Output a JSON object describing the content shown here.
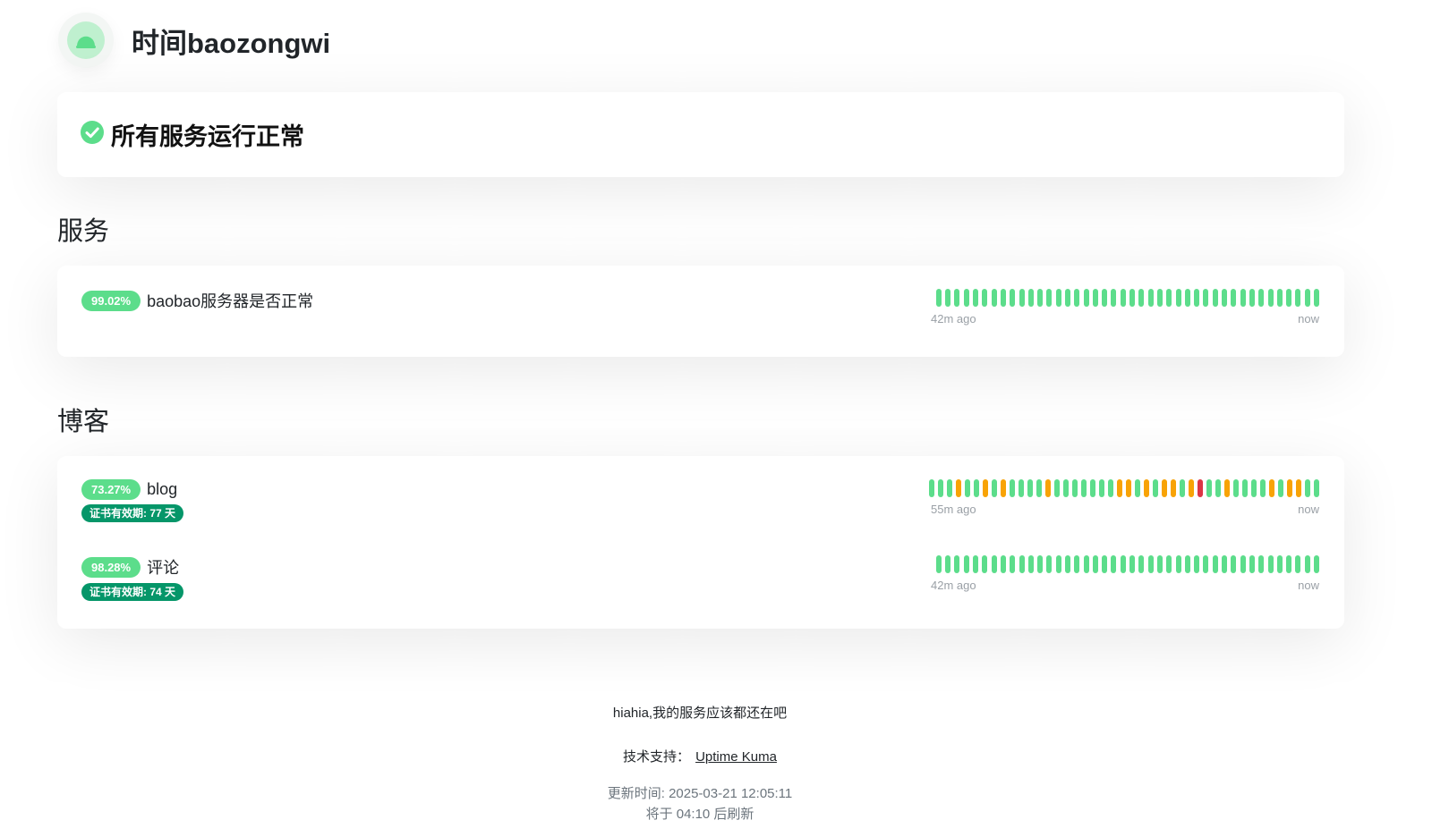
{
  "header": {
    "title": "时间baozongwi",
    "logo_icon": "kuma-logo-icon"
  },
  "overall_status": {
    "text": "所有服务运行正常",
    "icon": "check-circle-icon",
    "color": "#5cdd8b"
  },
  "colors": {
    "up": "#5cdd8b",
    "pending": "#f8a306",
    "down": "#dc3545",
    "cert": "#059669"
  },
  "groups": [
    {
      "title": "服务",
      "monitors": [
        {
          "uptime": "99.02%",
          "name": "baobao服务器是否正常",
          "cert": null,
          "from_label": "42m ago",
          "to_label": "now",
          "beats": [
            "up",
            "up",
            "up",
            "up",
            "up",
            "up",
            "up",
            "up",
            "up",
            "up",
            "up",
            "up",
            "up",
            "up",
            "up",
            "up",
            "up",
            "up",
            "up",
            "up",
            "up",
            "up",
            "up",
            "up",
            "up",
            "up",
            "up",
            "up",
            "up",
            "up",
            "up",
            "up",
            "up",
            "up",
            "up",
            "up",
            "up",
            "up",
            "up",
            "up",
            "up",
            "up"
          ]
        }
      ]
    },
    {
      "title": "博客",
      "monitors": [
        {
          "uptime": "73.27%",
          "name": "blog",
          "cert": "证书有效期: 77 天",
          "from_label": "55m ago",
          "to_label": "now",
          "beats": [
            "up",
            "up",
            "up",
            "pending",
            "up",
            "up",
            "pending",
            "up",
            "pending",
            "up",
            "up",
            "up",
            "up",
            "pending",
            "up",
            "up",
            "up",
            "up",
            "up",
            "up",
            "up",
            "pending",
            "pending",
            "up",
            "pending",
            "up",
            "pending",
            "pending",
            "up",
            "pending",
            "down",
            "up",
            "up",
            "pending",
            "up",
            "up",
            "up",
            "up",
            "pending",
            "up",
            "pending",
            "pending",
            "up",
            "up"
          ]
        },
        {
          "uptime": "98.28%",
          "name": "评论",
          "cert": "证书有效期: 74 天",
          "from_label": "42m ago",
          "to_label": "now",
          "beats": [
            "up",
            "up",
            "up",
            "up",
            "up",
            "up",
            "up",
            "up",
            "up",
            "up",
            "up",
            "up",
            "up",
            "up",
            "up",
            "up",
            "up",
            "up",
            "up",
            "up",
            "up",
            "up",
            "up",
            "up",
            "up",
            "up",
            "up",
            "up",
            "up",
            "up",
            "up",
            "up",
            "up",
            "up",
            "up",
            "up",
            "up",
            "up",
            "up",
            "up",
            "up",
            "up"
          ]
        }
      ]
    }
  ],
  "footer": {
    "description": "hiahia,我的服务应该都还在吧",
    "powered_prefix": "技术支持：",
    "powered_link": "Uptime Kuma",
    "updated": "更新时间: 2025-03-21 12:05:11",
    "refresh": "将于 04:10 后刷新"
  }
}
